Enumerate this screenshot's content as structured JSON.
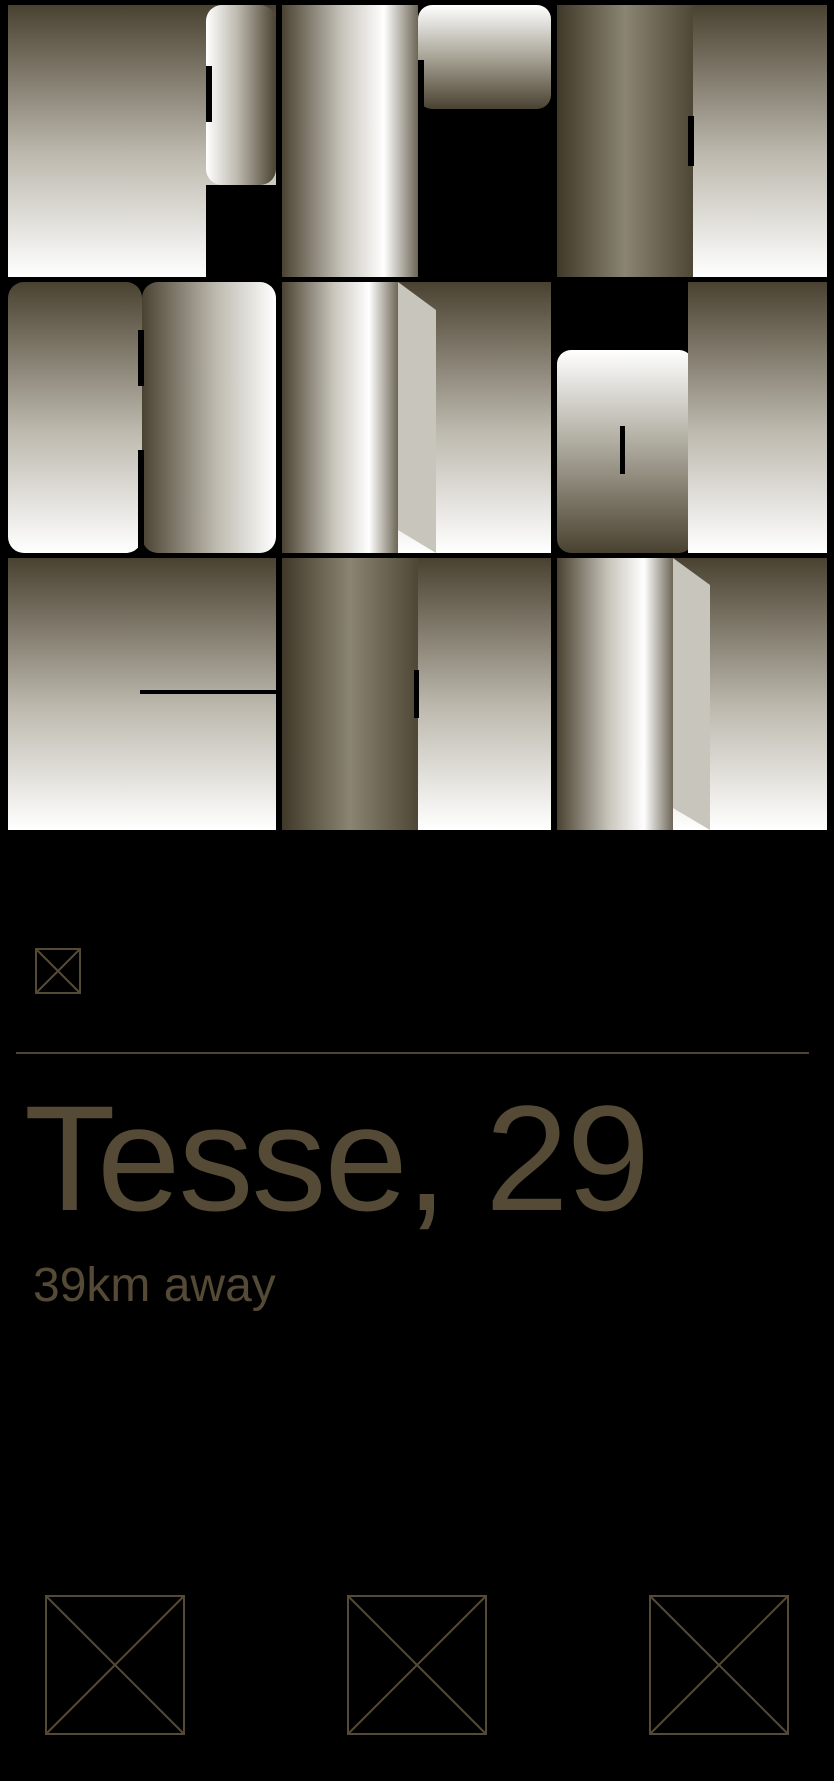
{
  "profile": {
    "name": "Tesse, 29",
    "distance": "39km away"
  },
  "icons": {
    "top_icon": "image-placeholder-icon",
    "actions": [
      "action-placeholder-icon",
      "action-placeholder-icon",
      "action-placeholder-icon"
    ]
  },
  "colors": {
    "background": "#000000",
    "accent": "#554a35"
  }
}
